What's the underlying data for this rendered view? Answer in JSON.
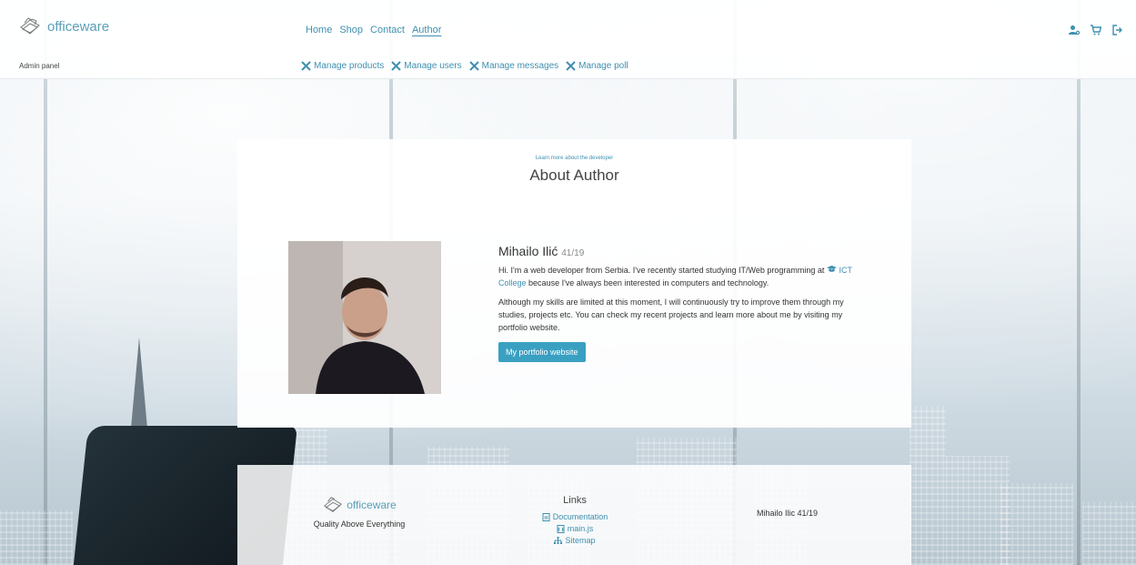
{
  "brand": {
    "name": "officeware",
    "tagline": "Quality Above Everything"
  },
  "nav": [
    "Home",
    "Shop",
    "Contact",
    "Author"
  ],
  "header_icons": [
    "user-gear-icon",
    "cart-icon",
    "logout-icon"
  ],
  "admin": {
    "label": "Admin panel",
    "items": [
      "Manage products",
      "Manage users",
      "Manage messages",
      "Manage poll"
    ]
  },
  "about": {
    "eyebrow": "Learn more about the developer",
    "title": "About Author",
    "name": "Mihailo Ilić",
    "index": "41/19",
    "p1_before": "Hi. I'm a web developer from Serbia. I've recently started studying IT/Web programming at",
    "college": "ICT College",
    "p1_after": "because I've always been interested in computers and technology.",
    "p2": "Although my skills are limited at this moment, I will continuously try to improve them through my studies, projects etc. You can check my recent projects and learn more about me by visiting my portfolio website.",
    "button": "My portfolio website"
  },
  "footer": {
    "links_title": "Links",
    "links": [
      "Documentation",
      "main.js",
      "Sitemap"
    ],
    "credit": "Mihailo Ilic 41/19"
  },
  "colors": {
    "accent": "#3f90b0",
    "button": "#3aa0c2"
  }
}
